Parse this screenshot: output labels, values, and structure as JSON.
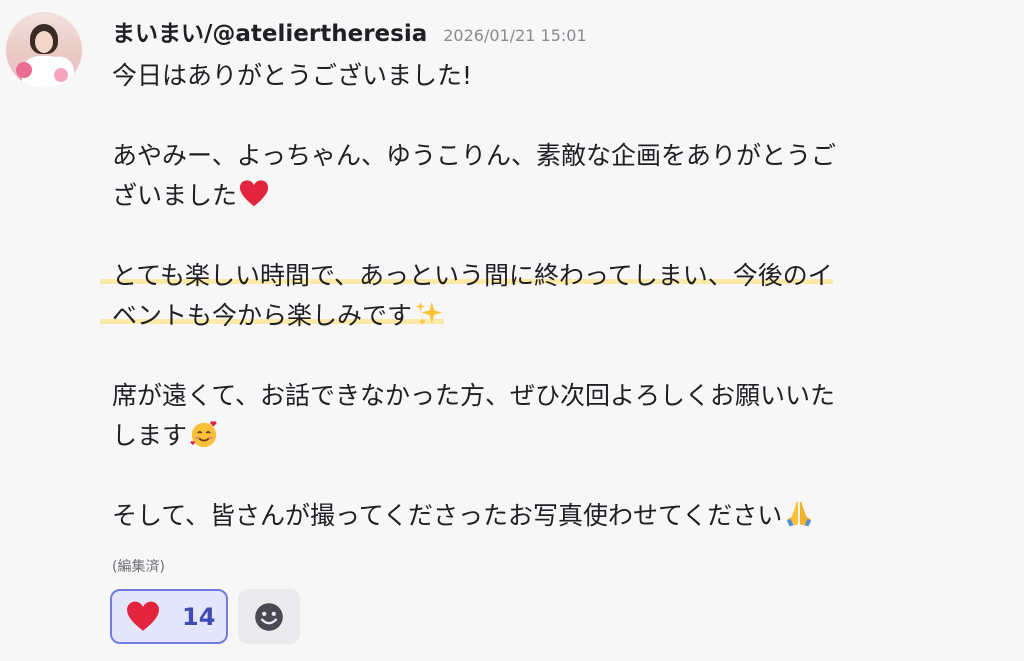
{
  "post": {
    "author": "まいまい/@ateliertheresia",
    "timestamp": "2026/01/21 15:01",
    "lines": [
      "今日はありがとうございました!",
      "あやみー、よっちゃん、ゆうこりん、素敵な企画をありがとうご",
      "ざいました",
      "とても楽しい時間で、あっという間に終わってしまい、今後のイ",
      "ベントも今から楽しみです",
      "席が遠くて、お話できなかった方、ぜひ次回よろしくお願いいた",
      "します",
      "そして、皆さんが撮ってくださったお写真使わせてください"
    ],
    "emojis": {
      "line3": "red-heart-icon",
      "line5": "sparkles-icon",
      "line7": "smiling-face-with-hearts-icon",
      "line8": "folded-hands-icon"
    },
    "edited_label": "(編集済)"
  },
  "reactions": [
    {
      "icon": "heart-icon",
      "count": "14",
      "selected": true
    }
  ],
  "add_reaction_icon": "smiley-icon",
  "colors": {
    "highlight": "#fbe9a8",
    "reaction_bg": "#e4e6fb",
    "reaction_border": "#6f7de3",
    "reaction_count": "#3e4bb2",
    "heart": "#e2243f"
  }
}
